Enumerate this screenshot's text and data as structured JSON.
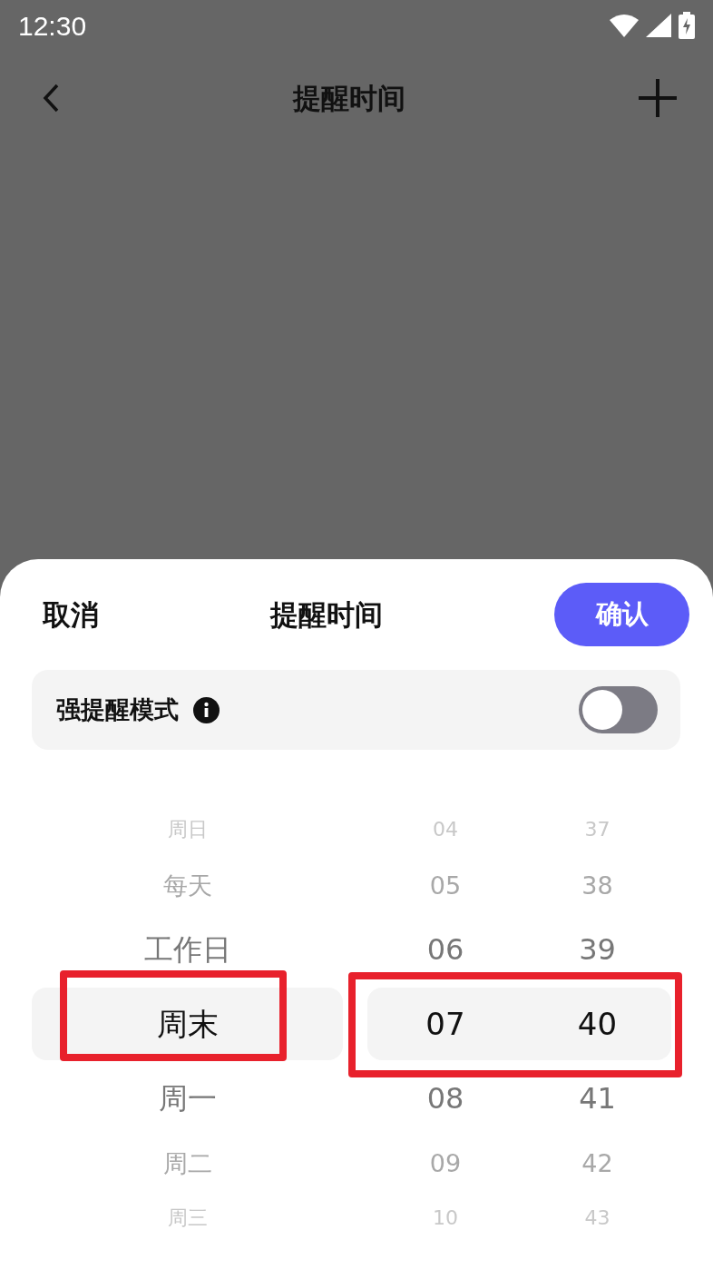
{
  "status_bar": {
    "time": "12:30"
  },
  "header": {
    "title": "提醒时间"
  },
  "sheet": {
    "cancel": "取消",
    "title": "提醒时间",
    "confirm": "确认",
    "strong_mode": {
      "label": "强提醒模式",
      "on": false
    },
    "picker": {
      "groups": [
        {
          "highlighted": true,
          "columns": [
            {
              "items": [
                {
                  "text": "周日",
                  "selected": false
                },
                {
                  "text": "每天",
                  "selected": false
                },
                {
                  "text": "工作日",
                  "selected": false
                },
                {
                  "text": "周末",
                  "selected": true
                },
                {
                  "text": "周一",
                  "selected": false
                },
                {
                  "text": "周二",
                  "selected": false
                },
                {
                  "text": "周三",
                  "selected": false
                }
              ]
            }
          ]
        },
        {
          "highlighted": true,
          "columns": [
            {
              "items": [
                {
                  "text": "04",
                  "selected": false
                },
                {
                  "text": "05",
                  "selected": false
                },
                {
                  "text": "06",
                  "selected": false
                },
                {
                  "text": "07",
                  "selected": true
                },
                {
                  "text": "08",
                  "selected": false
                },
                {
                  "text": "09",
                  "selected": false
                },
                {
                  "text": "10",
                  "selected": false
                }
              ]
            },
            {
              "items": [
                {
                  "text": "37",
                  "selected": false
                },
                {
                  "text": "38",
                  "selected": false
                },
                {
                  "text": "39",
                  "selected": false
                },
                {
                  "text": "40",
                  "selected": true
                },
                {
                  "text": "41",
                  "selected": false
                },
                {
                  "text": "42",
                  "selected": false
                },
                {
                  "text": "43",
                  "selected": false
                }
              ]
            }
          ]
        }
      ]
    }
  }
}
